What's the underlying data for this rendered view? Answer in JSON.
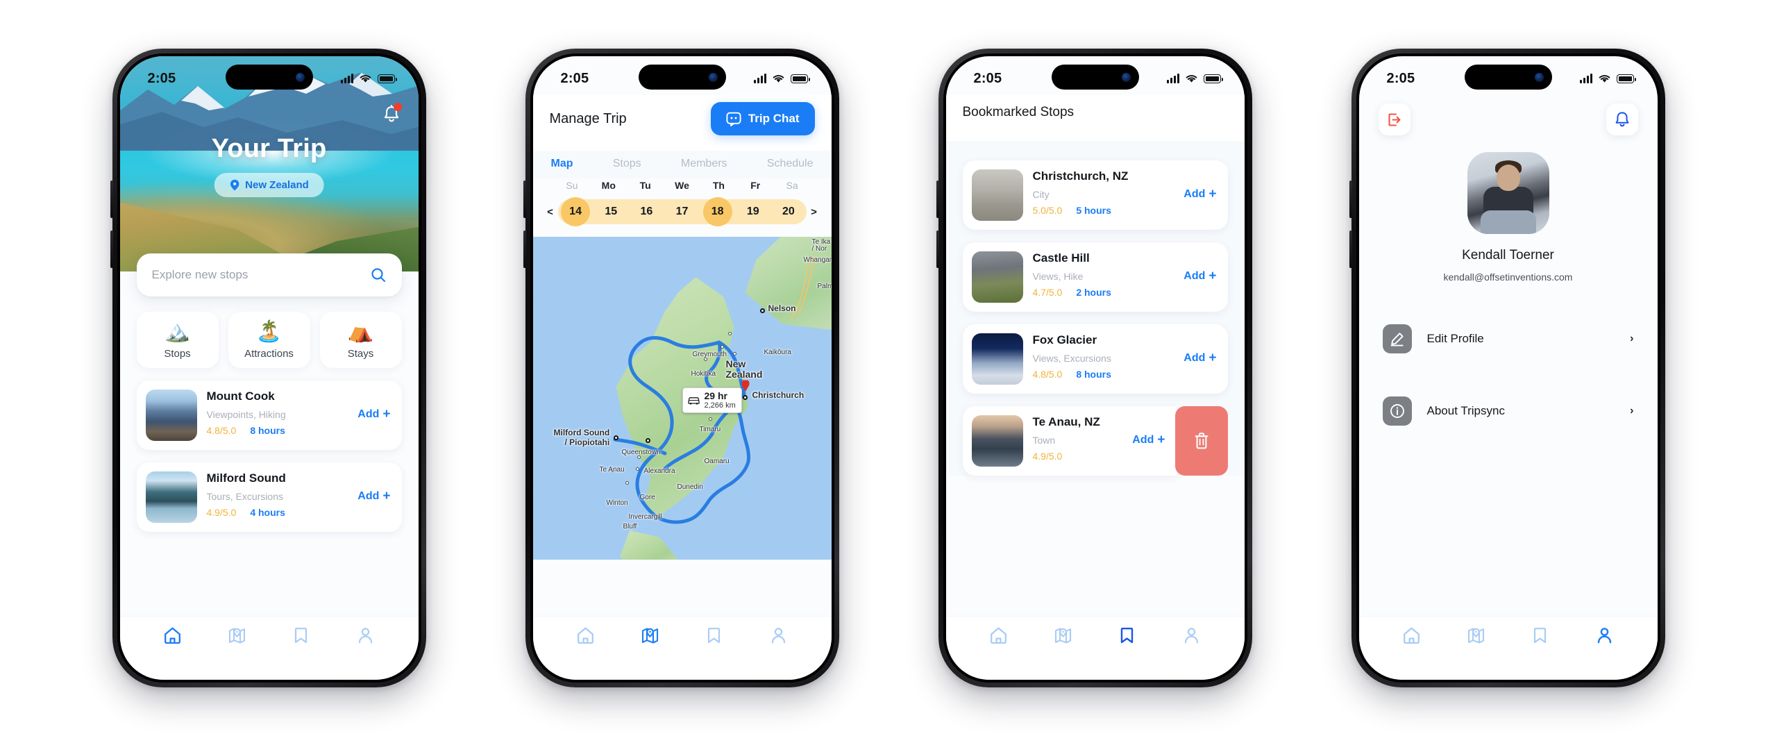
{
  "status_bar": {
    "time": "2:05",
    "signal_icon": "cellular-signal-icon",
    "wifi_icon": "wifi-icon",
    "battery_icon": "battery-icon"
  },
  "screen_home": {
    "hero": {
      "title": "Your Trip",
      "location_chip": "New Zealand",
      "location_pin_icon": "map-pin-icon",
      "notification_icon": "bell-icon",
      "notification_badge": ""
    },
    "search": {
      "placeholder": "Explore new stops",
      "icon": "search-icon"
    },
    "categories": [
      {
        "emoji": "🏔️",
        "label": "Stops",
        "icon": "mountain-icon"
      },
      {
        "emoji": "🏝️",
        "label": "Attractions",
        "icon": "island-icon"
      },
      {
        "emoji": "⛺",
        "label": "Stays",
        "icon": "tent-icon"
      }
    ],
    "stops": [
      {
        "name": "Mount Cook",
        "tags": "Viewpoints, Hiking",
        "rating": "4.8/5.0",
        "duration": "8 hours",
        "add_label": "Add",
        "thumb_class": "th-mtcook"
      },
      {
        "name": "Milford Sound",
        "tags": "Tours, Excursions",
        "rating": "4.9/5.0",
        "duration": "4 hours",
        "add_label": "Add",
        "thumb_class": "th-milford"
      }
    ],
    "tabbar": {
      "active": "home"
    }
  },
  "screen_manage": {
    "header": {
      "title": "Manage Trip",
      "chat_button": "Trip Chat",
      "chat_icon": "chat-bubble-icon"
    },
    "tabs": [
      {
        "label": "Map",
        "active": true
      },
      {
        "label": "Stops",
        "active": false
      },
      {
        "label": "Members",
        "active": false
      },
      {
        "label": "Schedule",
        "active": false
      }
    ],
    "calendar": {
      "prev_label": "<",
      "next_label": ">",
      "weekdays": [
        {
          "label": "Su",
          "dim": true
        },
        {
          "label": "Mo",
          "dim": false
        },
        {
          "label": "Tu",
          "dim": false
        },
        {
          "label": "We",
          "dim": false
        },
        {
          "label": "Th",
          "dim": false
        },
        {
          "label": "Fr",
          "dim": false
        },
        {
          "label": "Sa",
          "dim": true
        }
      ],
      "dates": [
        {
          "num": "14",
          "selected": true
        },
        {
          "num": "15",
          "selected": false
        },
        {
          "num": "16",
          "selected": false
        },
        {
          "num": "17",
          "selected": false
        },
        {
          "num": "18",
          "selected": true
        },
        {
          "num": "19",
          "selected": false
        },
        {
          "num": "20",
          "selected": false
        }
      ]
    },
    "map": {
      "duration": "29 hr",
      "distance": "2,266 km",
      "vehicle_icon": "car-icon",
      "country_label": "New\nZealand",
      "labels": [
        {
          "text": "Nelson",
          "bold": true
        },
        {
          "text": "Christchurch",
          "bold": true
        },
        {
          "text": "Milford Sound\n/ Piopiotahi",
          "bold": true
        },
        {
          "text": "Greymouth",
          "bold": false
        },
        {
          "text": "Hokitika",
          "bold": false
        },
        {
          "text": "Kaikōura",
          "bold": false
        },
        {
          "text": "Timaru",
          "bold": false
        },
        {
          "text": "Queenstown",
          "bold": false
        },
        {
          "text": "Te Anau",
          "bold": false
        },
        {
          "text": "Alexandra",
          "bold": false
        },
        {
          "text": "Oamaru",
          "bold": false
        },
        {
          "text": "Dunedin",
          "bold": false
        },
        {
          "text": "Gore",
          "bold": false
        },
        {
          "text": "Winton",
          "bold": false
        },
        {
          "text": "Invercargill",
          "bold": false
        },
        {
          "text": "Bluff",
          "bold": false
        },
        {
          "text": "Whangan",
          "bold": false
        },
        {
          "text": "Palm",
          "bold": false
        },
        {
          "text": "Te Ika",
          "bold": false
        },
        {
          "text": "/ Nor",
          "bold": false
        }
      ]
    },
    "tabbar": {
      "active": "map"
    }
  },
  "screen_bookmarks": {
    "title": "Bookmarked Stops",
    "stops": [
      {
        "name": "Christchurch, NZ",
        "tags": "City",
        "rating": "5.0/5.0",
        "duration": "5 hours",
        "add_label": "Add",
        "thumb_class": "th-christ"
      },
      {
        "name": "Castle Hill",
        "tags": "Views, Hike",
        "rating": "4.7/5.0",
        "duration": "2 hours",
        "add_label": "Add",
        "thumb_class": "th-castle"
      },
      {
        "name": "Fox Glacier",
        "tags": "Views, Excursions",
        "rating": "4.8/5.0",
        "duration": "8 hours",
        "add_label": "Add",
        "thumb_class": "th-fox"
      }
    ],
    "swiped_stop": {
      "name": "Te Anau, NZ",
      "tags": "Town",
      "rating": "4.9/5.0",
      "duration": "",
      "add_label": "Add",
      "thumb_class": "th-teanau",
      "delete_icon": "trash-icon"
    },
    "tabbar": {
      "active": "bookmarks"
    }
  },
  "screen_profile": {
    "logout_icon": "logout-icon",
    "notification_icon": "bell-icon",
    "avatar_name": "avatar",
    "name": "Kendall Toerner",
    "email": "kendall@offsetinventions.com",
    "menu": [
      {
        "label": "Edit Profile",
        "icon": "pencil-icon",
        "chevron": "›"
      },
      {
        "label": "About Tripsync",
        "icon": "info-icon",
        "chevron": "›"
      }
    ],
    "tabbar": {
      "active": "profile"
    }
  },
  "colors": {
    "accent_blue": "#1a7df5",
    "inactive_blue": "#a9ccf5",
    "rating_amber": "#f0b23c",
    "calendar_amber": "#f9c765",
    "calendar_band": "#fde7b6",
    "delete_red": "#ee7b73",
    "logout_red": "#f0554a"
  }
}
